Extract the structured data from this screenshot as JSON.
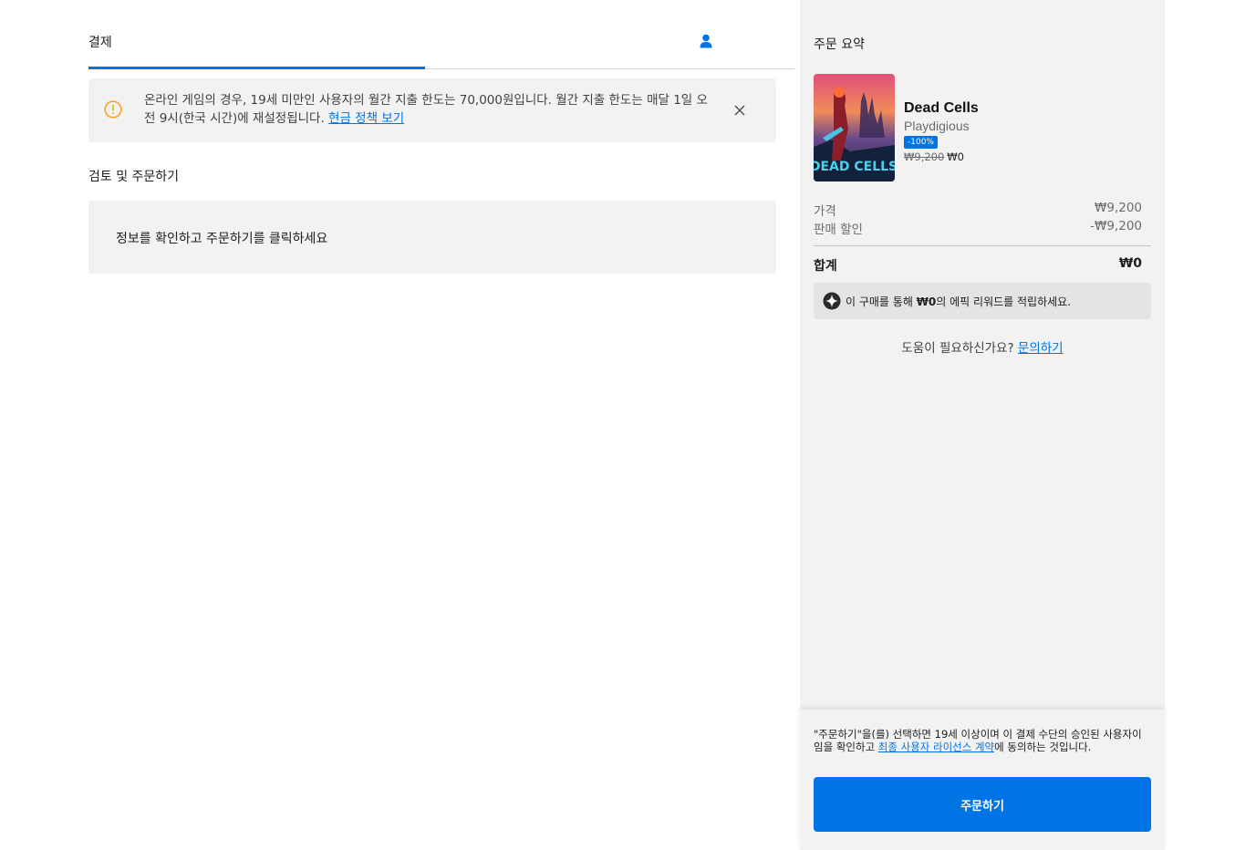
{
  "colors": {
    "accent": "#0074e4",
    "warning": "#f5a623",
    "panel": "#f2f2f2"
  },
  "header": {
    "tab_checkout": "결제",
    "user_icon": "user-icon"
  },
  "notice": {
    "icon": "warning-icon",
    "text": "온라인 게임의 경우, 19세 미만인 사용자의 월간 지출 한도는 70,000원입니다. 월간 지출 한도는 매달 1일 오전 9시(한국 시간)에 재설정됩니다. ",
    "link": "현금 정책 보기",
    "close_icon": "close-icon"
  },
  "review": {
    "title": "검토 및 주문하기",
    "message": "정보를 확인하고 주문하기를 클릭하세요"
  },
  "summary": {
    "title": "주문 요약",
    "product": {
      "name": "Dead Cells",
      "publisher": "Playdigious",
      "discount": "-100%",
      "original_price": "₩9,200",
      "sale_price": "₩0",
      "cover_text": "DEAD CELLS"
    },
    "price_label": "가격",
    "price_value": "₩9,200",
    "discount_label": "판매 할인",
    "discount_value": "-₩9,200",
    "total_label": "합계",
    "total_value": "₩0",
    "rewards_icon": "epic-rewards-icon",
    "rewards_prefix": "이 구매를 통해 ",
    "rewards_amount": "₩0",
    "rewards_suffix": "의 에픽 리워드를 적립하세요.",
    "help_text": "도움이 필요하신가요? ",
    "help_link": "문의하기"
  },
  "footer": {
    "legal_prefix": "\"주문하기\"을(를) 선택하면 19세 이상이며 이 결제 수단의 승인된 사용자이임을 확인하고 ",
    "legal_link": "최종 사용자 라이선스 계약",
    "legal_suffix": "에 동의하는 것입니다.",
    "order_button": "주문하기"
  }
}
